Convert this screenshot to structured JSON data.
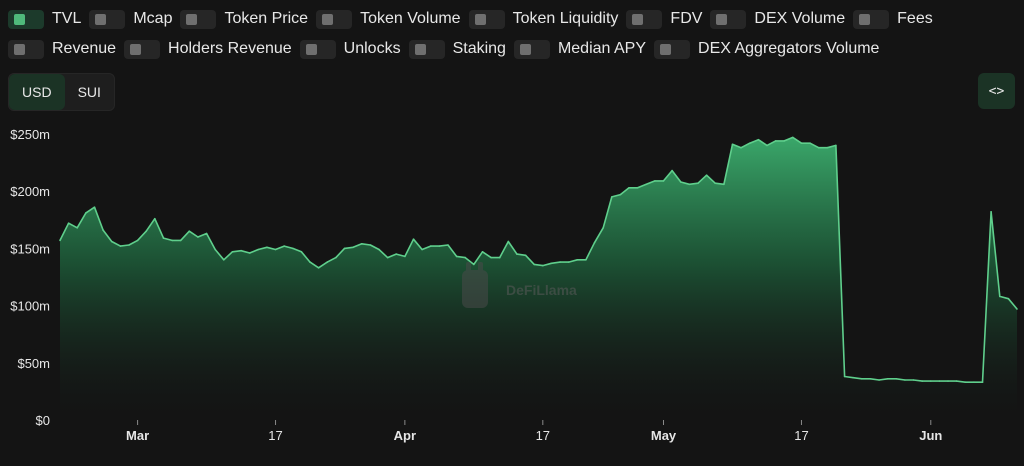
{
  "toggles": {
    "row1": [
      {
        "label": "TVL",
        "checked": true
      },
      {
        "label": "Mcap",
        "checked": false
      },
      {
        "label": "Token Price",
        "checked": false
      },
      {
        "label": "Token Volume",
        "checked": false
      },
      {
        "label": "Token Liquidity",
        "checked": false
      },
      {
        "label": "FDV",
        "checked": false
      },
      {
        "label": "DEX Volume",
        "checked": false
      },
      {
        "label": "Fees",
        "checked": false
      }
    ],
    "row2": [
      {
        "label": "Revenue",
        "checked": false
      },
      {
        "label": "Holders Revenue",
        "checked": false
      },
      {
        "label": "Unlocks",
        "checked": false
      },
      {
        "label": "Staking",
        "checked": false
      },
      {
        "label": "Median APY",
        "checked": false
      },
      {
        "label": "DEX Aggregators Volume",
        "checked": false
      }
    ]
  },
  "currency": {
    "options": [
      "USD",
      "SUI"
    ],
    "selected": "USD"
  },
  "embed_label": "<>",
  "watermark": "DeFiLlama",
  "colors": {
    "accent": "#4fba7b",
    "background": "#141414",
    "line": "#5fcf8c"
  },
  "chart_data": {
    "type": "area",
    "series": [
      {
        "name": "TVL",
        "x": [
          "2024-02-21",
          "2024-02-22",
          "2024-02-23",
          "2024-02-24",
          "2024-02-25",
          "2024-02-26",
          "2024-02-27",
          "2024-02-28",
          "2024-02-29",
          "2024-03-01",
          "2024-03-02",
          "2024-03-03",
          "2024-03-04",
          "2024-03-05",
          "2024-03-06",
          "2024-03-07",
          "2024-03-08",
          "2024-03-09",
          "2024-03-10",
          "2024-03-11",
          "2024-03-12",
          "2024-03-13",
          "2024-03-14",
          "2024-03-15",
          "2024-03-16",
          "2024-03-17",
          "2024-03-18",
          "2024-03-19",
          "2024-03-20",
          "2024-03-21",
          "2024-03-22",
          "2024-03-23",
          "2024-03-24",
          "2024-03-25",
          "2024-03-26",
          "2024-03-27",
          "2024-03-28",
          "2024-03-29",
          "2024-03-30",
          "2024-03-31",
          "2024-04-01",
          "2024-04-02",
          "2024-04-03",
          "2024-04-04",
          "2024-04-05",
          "2024-04-06",
          "2024-04-07",
          "2024-04-08",
          "2024-04-09",
          "2024-04-10",
          "2024-04-11",
          "2024-04-12",
          "2024-04-13",
          "2024-04-14",
          "2024-04-15",
          "2024-04-16",
          "2024-04-17",
          "2024-04-18",
          "2024-04-19",
          "2024-04-20",
          "2024-04-21",
          "2024-04-22",
          "2024-04-23",
          "2024-04-24",
          "2024-04-25",
          "2024-04-26",
          "2024-04-27",
          "2024-04-28",
          "2024-04-29",
          "2024-04-30",
          "2024-05-01",
          "2024-05-02",
          "2024-05-03",
          "2024-05-04",
          "2024-05-05",
          "2024-05-06",
          "2024-05-07",
          "2024-05-08",
          "2024-05-09",
          "2024-05-10",
          "2024-05-11",
          "2024-05-12",
          "2024-05-13",
          "2024-05-14",
          "2024-05-15",
          "2024-05-16",
          "2024-05-17",
          "2024-05-18",
          "2024-05-19",
          "2024-05-20",
          "2024-05-21",
          "2024-05-22",
          "2024-05-23",
          "2024-05-24",
          "2024-05-25",
          "2024-05-26",
          "2024-05-27",
          "2024-05-28",
          "2024-05-29",
          "2024-05-30",
          "2024-05-31",
          "2024-06-01",
          "2024-06-02",
          "2024-06-03",
          "2024-06-04",
          "2024-06-05",
          "2024-06-06",
          "2024-06-07",
          "2024-06-08",
          "2024-06-09",
          "2024-06-10",
          "2024-06-11"
        ],
        "values": [
          157,
          172,
          168,
          181,
          186,
          166,
          156,
          152,
          153,
          157,
          165,
          176,
          159,
          157,
          157,
          165,
          160,
          163,
          149,
          140,
          147,
          148,
          146,
          149,
          151,
          149,
          152,
          150,
          147,
          138,
          133,
          138,
          142,
          150,
          151,
          154,
          153,
          149,
          142,
          145,
          143,
          158,
          149,
          152,
          152,
          153,
          143,
          142,
          136,
          147,
          142,
          142,
          156,
          145,
          144,
          136,
          135,
          137,
          138,
          138,
          140,
          140,
          155,
          168,
          195,
          197,
          203,
          203,
          206,
          209,
          209,
          218,
          208,
          206,
          207,
          214,
          207,
          206,
          241,
          238,
          242,
          245,
          240,
          244,
          244,
          247,
          242,
          242,
          238,
          238,
          240,
          38,
          37,
          36,
          36,
          35,
          36,
          36,
          35,
          35,
          34,
          34,
          34,
          34,
          34,
          33,
          33,
          33,
          182,
          108,
          106,
          97
        ]
      }
    ],
    "x_ticks": [
      {
        "date": "2024-03-01",
        "label": "Mar",
        "bold": true
      },
      {
        "date": "2024-03-17",
        "label": "17",
        "bold": false
      },
      {
        "date": "2024-04-01",
        "label": "Apr",
        "bold": true
      },
      {
        "date": "2024-04-17",
        "label": "17",
        "bold": false
      },
      {
        "date": "2024-05-01",
        "label": "May",
        "bold": true
      },
      {
        "date": "2024-05-17",
        "label": "17",
        "bold": false
      },
      {
        "date": "2024-06-01",
        "label": "Jun",
        "bold": true
      }
    ],
    "y_ticks": [
      {
        "value": 0,
        "label": "$0"
      },
      {
        "value": 50,
        "label": "$50m"
      },
      {
        "value": 100,
        "label": "$100m"
      },
      {
        "value": 150,
        "label": "$150m"
      },
      {
        "value": 200,
        "label": "$200m"
      },
      {
        "value": 250,
        "label": "$250m"
      }
    ],
    "ylim": [
      0,
      250
    ],
    "xlim": [
      "2024-02-21",
      "2024-06-11"
    ],
    "grid": false,
    "legend": "none"
  }
}
